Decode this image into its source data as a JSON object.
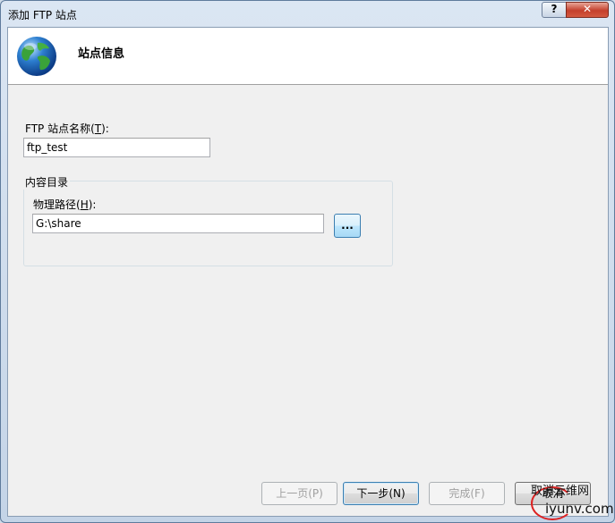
{
  "window": {
    "title": "添加 FTP 站点",
    "help_label": "?",
    "close_label": "✕"
  },
  "header": {
    "title": "站点信息",
    "icon": "globe-icon"
  },
  "site_name": {
    "label_prefix": "FTP 站点名称(",
    "label_mnemonic": "T",
    "label_suffix": "):",
    "value": "ftp_test"
  },
  "content_dir": {
    "group_title": "内容目录",
    "path_label_prefix": "物理路径(",
    "path_label_mnemonic": "H",
    "path_label_suffix": "):",
    "path_value": "G:\\share",
    "browse_label": "..."
  },
  "footer": {
    "prev_label": "上一页(P)",
    "next_label": "下一步(N)",
    "finish_label": "完成(F)",
    "cancel_label": "取消"
  },
  "watermark": {
    "line1": "取消云维网",
    "line2": "iyunv.com"
  },
  "colors": {
    "accent": "#3c7fb1",
    "close_red": "#c4402c"
  }
}
